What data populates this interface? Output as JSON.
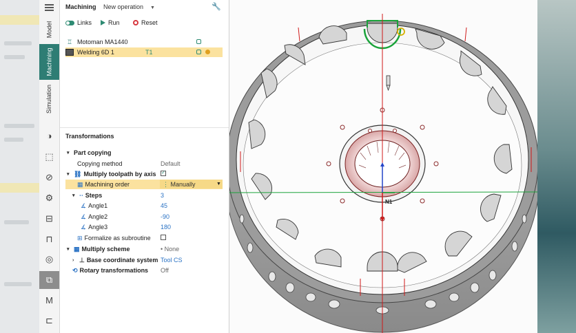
{
  "rail": {
    "tabs": [
      {
        "label": "Model"
      },
      {
        "label": "Machining"
      },
      {
        "label": "Simulation"
      }
    ]
  },
  "panel": {
    "title": "Machining",
    "operation_select": "New operation",
    "toolbar": {
      "links_label": "Links",
      "run_label": "Run",
      "reset_label": "Reset"
    },
    "tree": [
      {
        "label": "Motoman MA1440",
        "extra": ""
      },
      {
        "label": "Welding 6D 1",
        "extra": "T1"
      }
    ],
    "section_title": "Transformations",
    "props": {
      "part_copying": "Part copying",
      "copying_method": {
        "label": "Copying method",
        "value": "Default"
      },
      "multiply_axis": {
        "label": "Multiply toolpath by axis"
      },
      "machining_order": {
        "label": "Machining order",
        "value": "Manually"
      },
      "steps": {
        "label": "Steps",
        "value": "3"
      },
      "angle1": {
        "label": "Angle1",
        "value": "45"
      },
      "angle2": {
        "label": "Angle2",
        "value": "-90"
      },
      "angle3": {
        "label": "Angle3",
        "value": "180"
      },
      "formalize": {
        "label": "Formalize as subroutine"
      },
      "multiply_scheme": {
        "label": "Multiply scheme",
        "value": "None"
      },
      "base_cs": {
        "label": "Base coordinate system",
        "value": "Tool CS"
      },
      "rotary": {
        "label": "Rotary transformations",
        "value": "Off"
      }
    }
  },
  "viewport": {
    "point_label": "N1"
  }
}
